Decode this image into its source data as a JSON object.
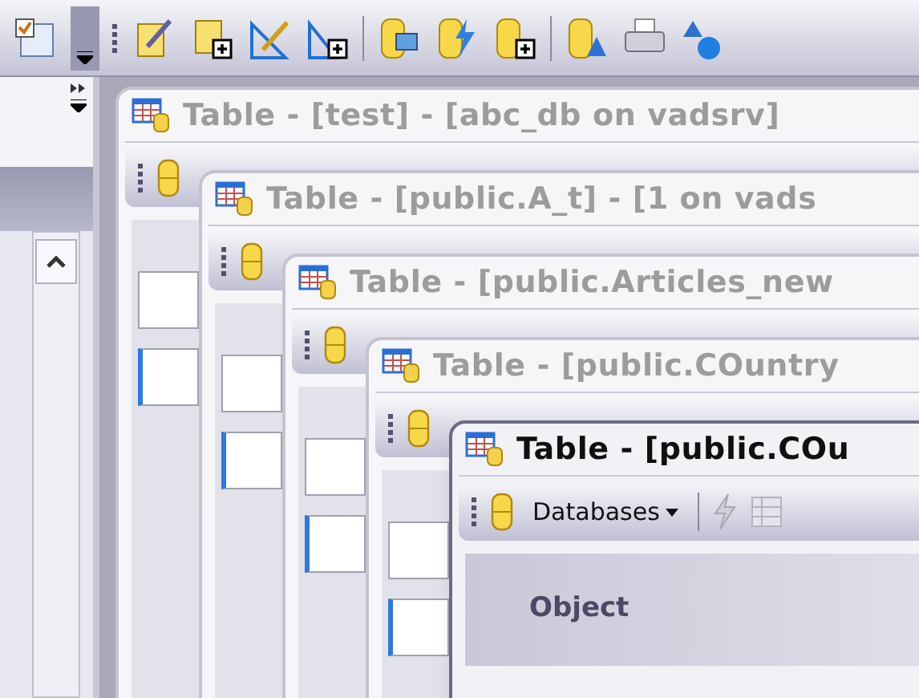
{
  "windows": [
    {
      "title": "Table - [test] - [abc_db on vadsrv]",
      "active": false
    },
    {
      "title": "Table - [public.A_t] - [1 on vads",
      "active": false
    },
    {
      "title": "Table - [public.Articles_new",
      "active": false
    },
    {
      "title": "Table - [public.COuntry",
      "active": false
    },
    {
      "title": "Table - [public.COu",
      "active": true,
      "toolbar": {
        "databases_label": "Databases"
      },
      "columns": [
        "Object"
      ]
    }
  ]
}
